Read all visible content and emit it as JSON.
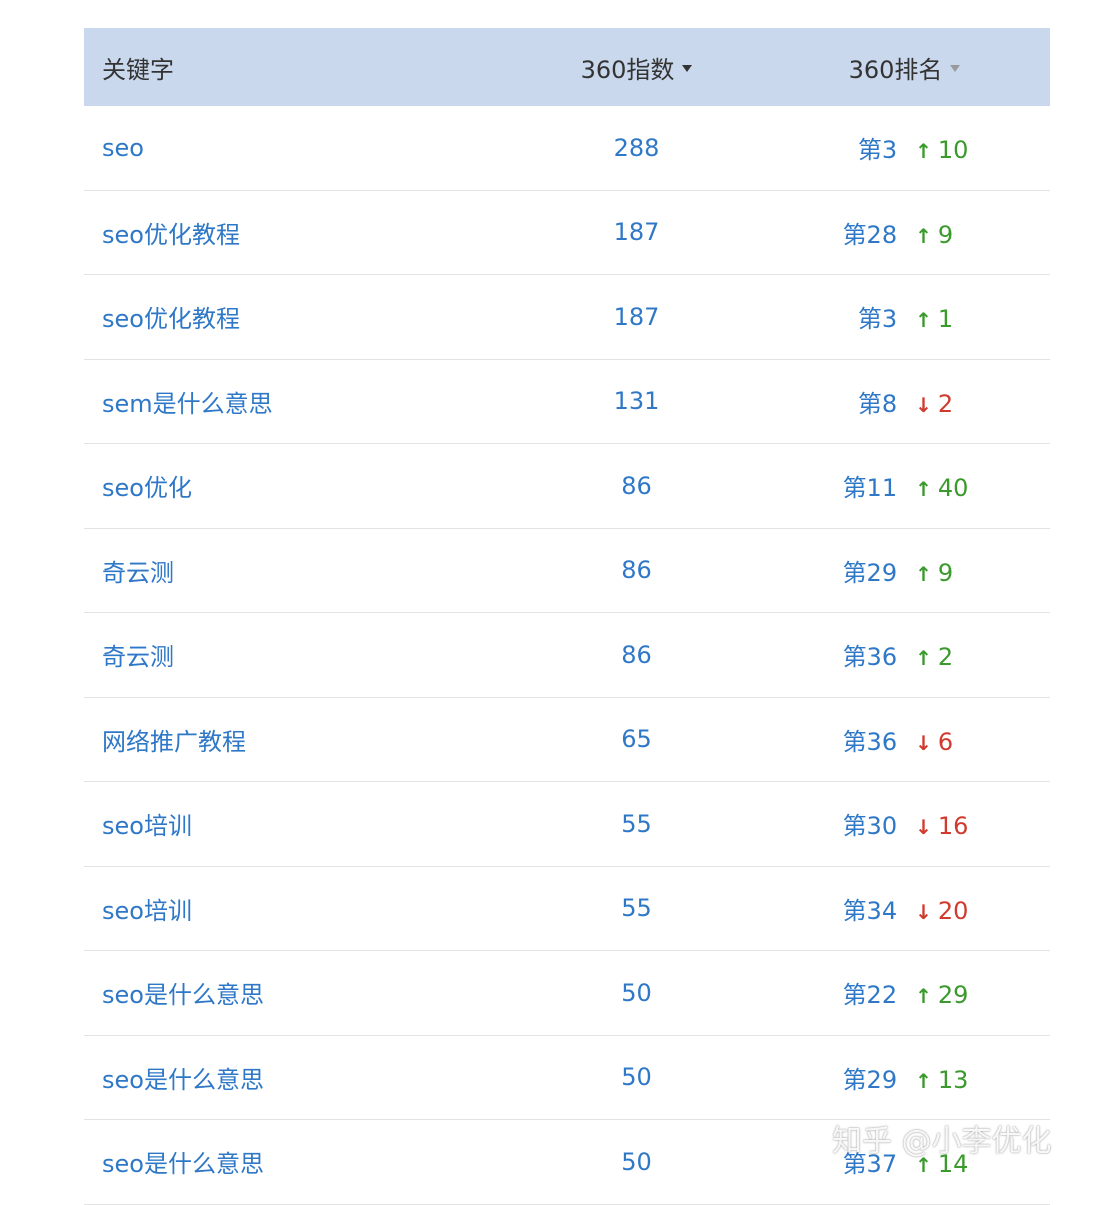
{
  "header": {
    "keyword": "关键字",
    "index": "360指数",
    "rank": "360排名"
  },
  "rows": [
    {
      "keyword": "seo",
      "index": "288",
      "rank": "第3",
      "trend": "up",
      "delta": "10"
    },
    {
      "keyword": "seo优化教程",
      "index": "187",
      "rank": "第28",
      "trend": "up",
      "delta": "9"
    },
    {
      "keyword": "seo优化教程",
      "index": "187",
      "rank": "第3",
      "trend": "up",
      "delta": "1"
    },
    {
      "keyword": "sem是什么意思",
      "index": "131",
      "rank": "第8",
      "trend": "down",
      "delta": "2"
    },
    {
      "keyword": "seo优化",
      "index": "86",
      "rank": "第11",
      "trend": "up",
      "delta": "40"
    },
    {
      "keyword": "奇云测",
      "index": "86",
      "rank": "第29",
      "trend": "up",
      "delta": "9"
    },
    {
      "keyword": "奇云测",
      "index": "86",
      "rank": "第36",
      "trend": "up",
      "delta": "2"
    },
    {
      "keyword": "网络推广教程",
      "index": "65",
      "rank": "第36",
      "trend": "down",
      "delta": "6"
    },
    {
      "keyword": "seo培训",
      "index": "55",
      "rank": "第30",
      "trend": "down",
      "delta": "16"
    },
    {
      "keyword": "seo培训",
      "index": "55",
      "rank": "第34",
      "trend": "down",
      "delta": "20"
    },
    {
      "keyword": "seo是什么意思",
      "index": "50",
      "rank": "第22",
      "trend": "up",
      "delta": "29"
    },
    {
      "keyword": "seo是什么意思",
      "index": "50",
      "rank": "第29",
      "trend": "up",
      "delta": "13"
    },
    {
      "keyword": "seo是什么意思",
      "index": "50",
      "rank": "第37",
      "trend": "up",
      "delta": "14"
    }
  ],
  "watermark": "知乎 @小李优化",
  "colors": {
    "header_bg": "#c9d8ec",
    "link": "#2f78c7",
    "up": "#3a9a2c",
    "down": "#d03a2f"
  }
}
